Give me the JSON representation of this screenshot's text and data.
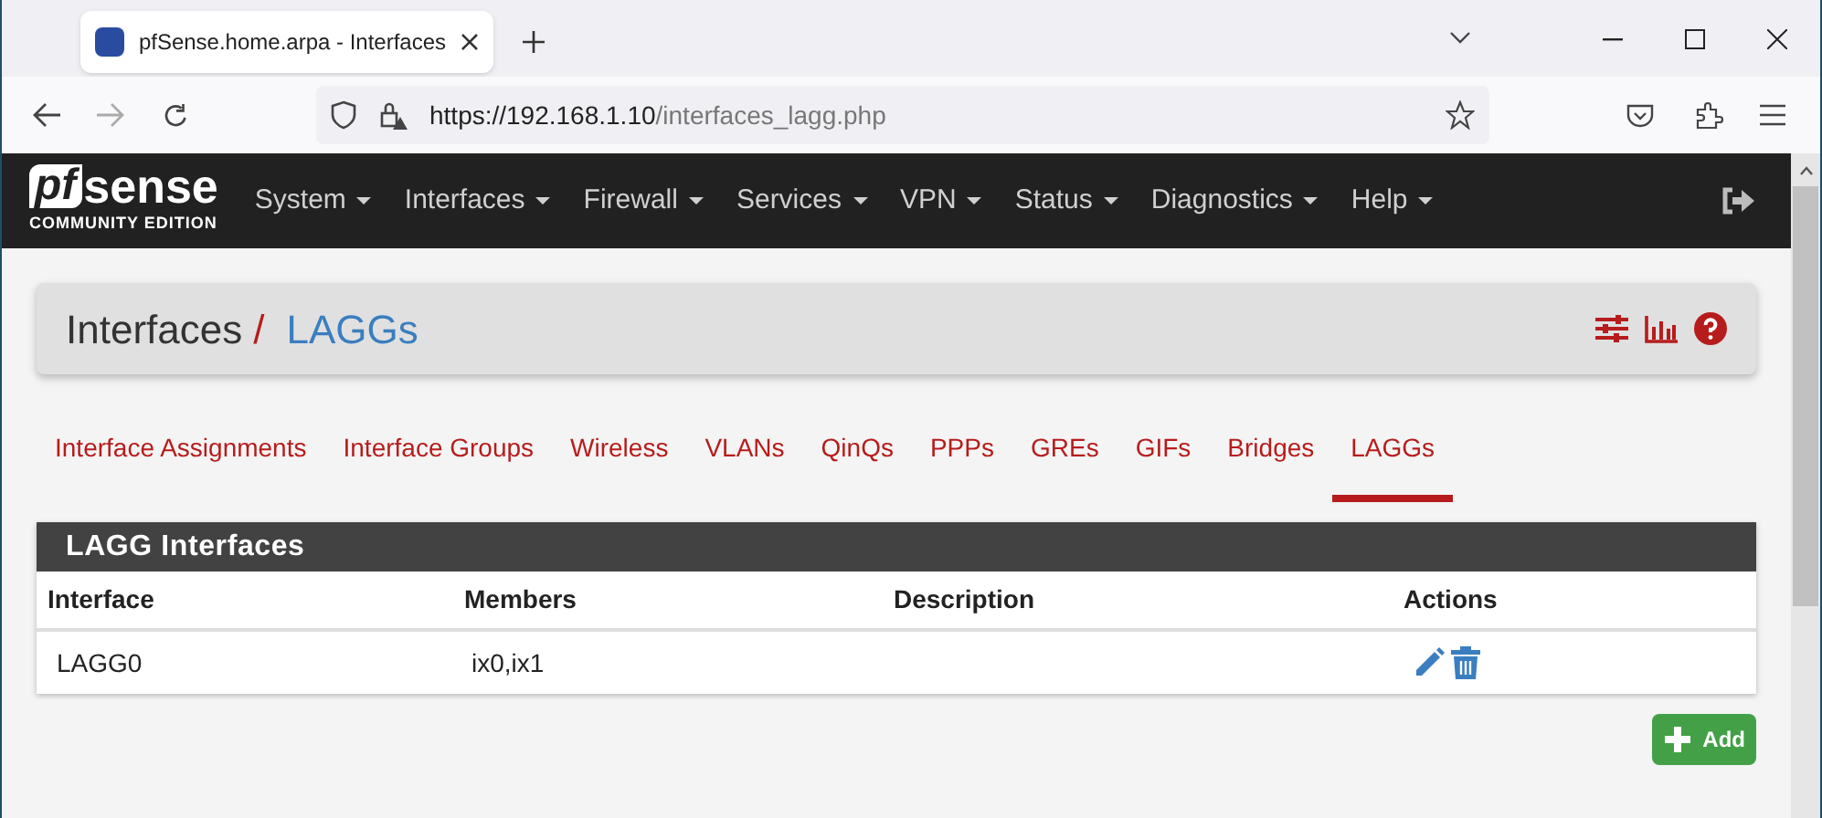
{
  "browser": {
    "tab_title": "pfSense.home.arpa - Interfaces",
    "url_host": "https://192.168.1.10",
    "url_path": "/interfaces_lagg.php"
  },
  "navbar": {
    "logo": "sense",
    "logo_prefix": "pf",
    "edition": "COMMUNITY EDITION",
    "menus": [
      "System",
      "Interfaces",
      "Firewall",
      "Services",
      "VPN",
      "Status",
      "Diagnostics",
      "Help"
    ]
  },
  "breadcrumb": {
    "parent": "Interfaces",
    "separator": "/",
    "current": "LAGGs"
  },
  "tabs": [
    {
      "label": "Interface Assignments",
      "selected": false
    },
    {
      "label": "Interface Groups",
      "selected": false
    },
    {
      "label": "Wireless",
      "selected": false
    },
    {
      "label": "VLANs",
      "selected": false
    },
    {
      "label": "QinQs",
      "selected": false
    },
    {
      "label": "PPPs",
      "selected": false
    },
    {
      "label": "GREs",
      "selected": false
    },
    {
      "label": "GIFs",
      "selected": false
    },
    {
      "label": "Bridges",
      "selected": false
    },
    {
      "label": "LAGGs",
      "selected": true
    }
  ],
  "table": {
    "title": "LAGG Interfaces",
    "columns": [
      "Interface",
      "Members",
      "Description",
      "Actions"
    ],
    "rows": [
      {
        "interface": "LAGG0",
        "members": "ix0,ix1"
      }
    ]
  },
  "add_button": "Add"
}
